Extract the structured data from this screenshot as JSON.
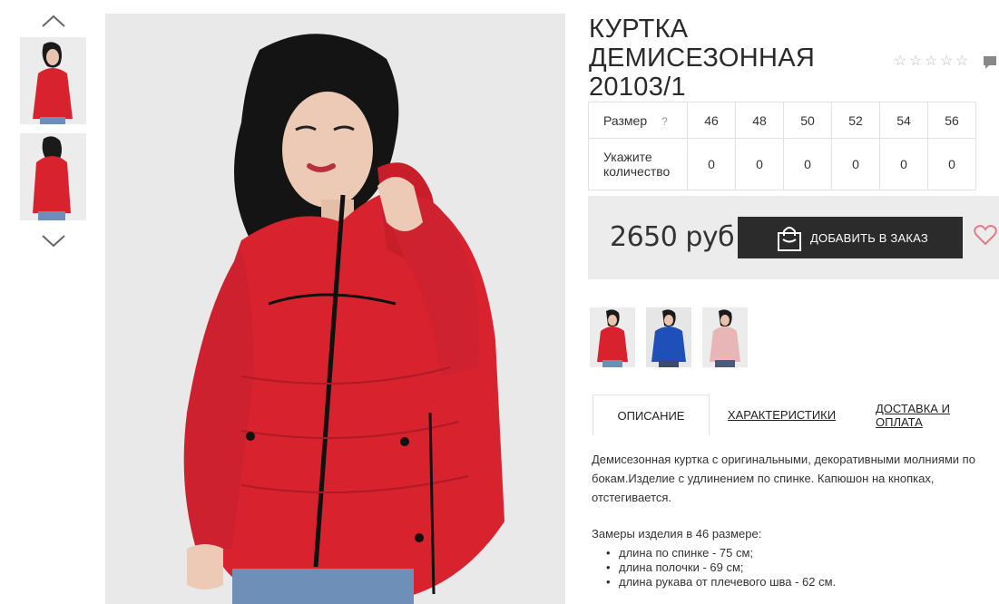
{
  "product": {
    "title": "КУРТКА ДЕМИСЕЗОННАЯ 20103/1",
    "rating": 0,
    "rating_max": 5,
    "price": "2650 руб"
  },
  "size_table": {
    "size_label": "Размер",
    "help_icon": "?",
    "qty_label": "Укажите количество",
    "sizes": [
      "46",
      "48",
      "50",
      "52",
      "54",
      "56"
    ],
    "quantities": [
      "0",
      "0",
      "0",
      "0",
      "0",
      "0"
    ]
  },
  "buy": {
    "add_label": "ДОБАВИТЬ В ЗАКАЗ"
  },
  "tabs": [
    {
      "label": "ОПИСАНИЕ",
      "active": true
    },
    {
      "label": "ХАРАКТЕРИСТИКИ",
      "active": false
    },
    {
      "label": "ДОСТАВКА И ОПЛАТА",
      "active": false
    }
  ],
  "description": {
    "text": "Демисезонная куртка с оригинальными, декоративными молниями по бокам.Изделие с удлинением по спинке. Капюшон на кнопках, отстегивается.",
    "measurements_title": "Замеры изделия в 46 размере:",
    "measurements": [
      "длина по спинке - 75 см;",
      "длина полочки - 69 см;",
      "длина рукава от плечевого шва - 62 см."
    ]
  },
  "colors": {
    "accent_dark": "#2b2b2b",
    "jacket_red": "#d8232f",
    "heart_pink": "#e07b86",
    "variant_colors": [
      "#d8232f",
      "#1f4fb8",
      "#e8b6b6"
    ]
  },
  "icons": {
    "up": "chevron-up-icon",
    "down": "chevron-down-icon",
    "star": "star-outline-icon",
    "comment": "comment-icon",
    "bag": "shopping-bag-icon",
    "heart": "heart-icon"
  }
}
